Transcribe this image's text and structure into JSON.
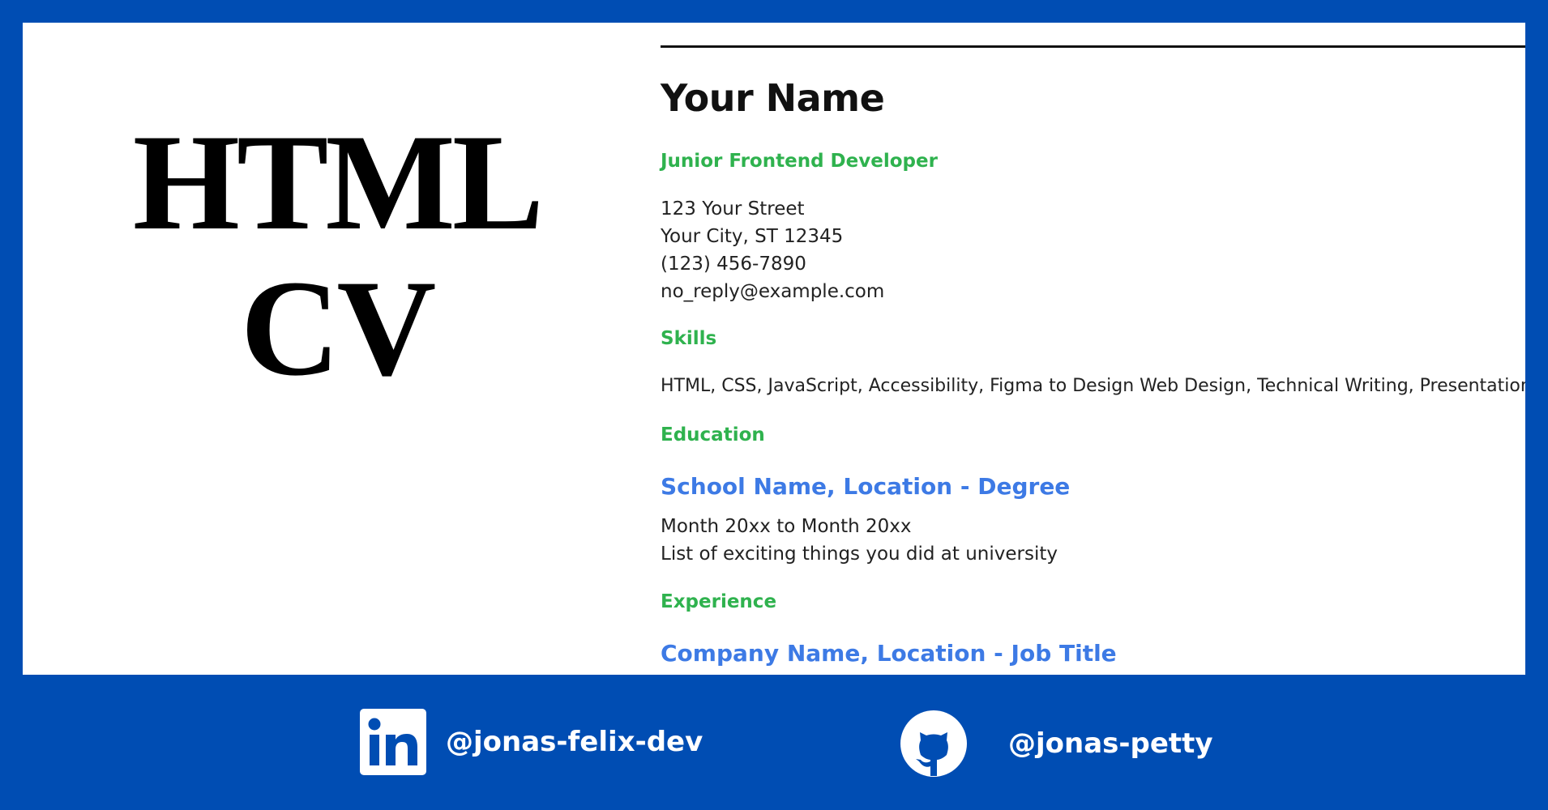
{
  "left_title": {
    "line1": "HTML",
    "line2": "CV"
  },
  "cv": {
    "name": "Your Name",
    "role": "Junior Frontend Developer",
    "address": [
      "123 Your Street",
      "Your City, ST 12345",
      "(123) 456-7890",
      "no_reply@example.com"
    ],
    "skills_heading": "Skills",
    "skills_text": "HTML, CSS, JavaScript, Accessibility, Figma to Design Web Design, Technical Writing, Presentation",
    "education_heading": "Education",
    "education_school": "School Name, Location - Degree",
    "education_dates": "Month 20xx to Month 20xx",
    "education_desc": "List of exciting things you did at university",
    "experience_heading": "Experience",
    "experience_company": "Company Name, Location - Job Title"
  },
  "footer": {
    "linkedin_icon": "linkedin-icon",
    "linkedin_handle": "@jonas-felix-dev",
    "github_icon": "github-icon",
    "github_handle": "@jonas-petty"
  },
  "colors": {
    "background": "#004db3",
    "panel": "#ffffff",
    "section_green": "#2fb24e",
    "link_blue": "#3d7ae5"
  }
}
